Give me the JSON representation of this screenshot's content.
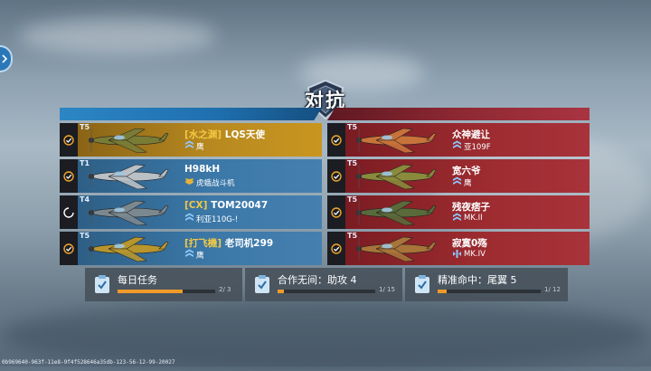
{
  "title": "对抗",
  "colors": {
    "accent_left": "#2d86c4",
    "accent_right": "#a93441",
    "progress": "#f19a2a"
  },
  "left_team": [
    {
      "tier": "T5",
      "clan": "[水之渊]",
      "name": "LQS天使",
      "aircraft": "鹰",
      "aircraft_icon": "rank-chevron-icon",
      "ready": true,
      "highlight": "gold",
      "plane_color": "#7a7c36"
    },
    {
      "tier": "T1",
      "clan": "",
      "name": "H98kH",
      "aircraft": "虎蛾战斗机",
      "aircraft_icon": "wings-icon",
      "ready": true,
      "highlight": "blue",
      "plane_color": "#b9c0c6"
    },
    {
      "tier": "T4",
      "clan": "[CX]",
      "name": "TOM20047",
      "aircraft": "利亚110G-!",
      "aircraft_icon": "rank-chevron-icon",
      "ready": false,
      "highlight": "blue",
      "plane_color": "#7c8890"
    },
    {
      "tier": "T5",
      "clan": "[打飞機]",
      "name": "老司机299",
      "aircraft": "鹰",
      "aircraft_icon": "rank-chevron-icon",
      "ready": true,
      "highlight": "blue",
      "plane_color": "#b8962e"
    }
  ],
  "right_team": [
    {
      "tier": "T5",
      "clan": "",
      "name": "众神避让",
      "aircraft": "亚109F",
      "aircraft_icon": "rank-chevron-icon",
      "ready": true,
      "highlight": "red",
      "plane_color": "#c8733a"
    },
    {
      "tier": "T5",
      "clan": "",
      "name": "宽六爷",
      "aircraft": "鹰",
      "aircraft_icon": "rank-chevron-icon",
      "ready": true,
      "highlight": "red",
      "plane_color": "#8a8a3c"
    },
    {
      "tier": "T5",
      "clan": "",
      "name": "残夜痞子",
      "aircraft": "MK.II",
      "aircraft_icon": "rank-chevron-icon",
      "ready": true,
      "highlight": "red",
      "plane_color": "#5a6a3a"
    },
    {
      "tier": "T5",
      "clan": "",
      "name": "寂寞0殇",
      "aircraft": "MK.IV",
      "aircraft_icon": "wing-marker-icon",
      "ready": true,
      "highlight": "red",
      "plane_color": "#a8743a"
    }
  ],
  "daily": [
    {
      "label": "每日任务",
      "current": 2,
      "total": 3,
      "count_text": "2/ 3"
    },
    {
      "label": "合作无间：助攻 4",
      "current": 1,
      "total": 15,
      "count_text": "1/ 15"
    },
    {
      "label": "精准命中：尾翼 5",
      "current": 1,
      "total": 12,
      "count_text": "1/ 12"
    }
  ],
  "footer_code": "0b969640-963f-11e8-9f4f528646a35db-123-56-12-99-20027"
}
